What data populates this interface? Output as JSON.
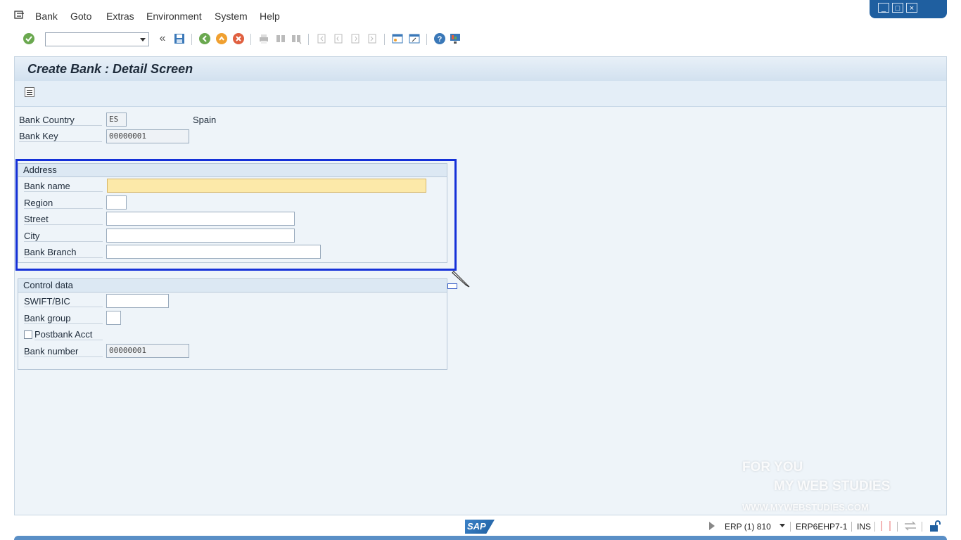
{
  "menubar": {
    "items": [
      "Bank",
      "Goto",
      "Extras",
      "Environment",
      "System",
      "Help"
    ]
  },
  "toolbar": {
    "command_field": "",
    "icons": [
      "enter-icon",
      "back-double-icon",
      "save-icon",
      "back-icon",
      "exit-icon",
      "cancel-icon",
      "print-icon",
      "find-icon",
      "find-next-icon",
      "first-page-icon",
      "prev-page-icon",
      "next-page-icon",
      "last-page-icon",
      "new-session-icon",
      "shortcut-icon",
      "help-icon",
      "customize-icon"
    ]
  },
  "screen": {
    "title": "Create Bank : Detail Screen"
  },
  "header_fields": {
    "bank_country_label": "Bank Country",
    "bank_country_value": "ES",
    "bank_country_name": "Spain",
    "bank_key_label": "Bank Key",
    "bank_key_value": "00000001"
  },
  "address": {
    "title": "Address",
    "bank_name_label": "Bank name",
    "bank_name_value": "",
    "region_label": "Region",
    "region_value": "",
    "street_label": "Street",
    "street_value": "",
    "city_label": "City",
    "city_value": "",
    "bank_branch_label": "Bank Branch",
    "bank_branch_value": ""
  },
  "control": {
    "title": "Control data",
    "swift_label": "SWIFT/BIC",
    "swift_value": "",
    "bank_group_label": "Bank group",
    "bank_group_value": "",
    "postbank_label": "Postbank Acct",
    "postbank_checked": false,
    "bank_number_label": "Bank number",
    "bank_number_value": "00000001"
  },
  "watermark": {
    "line1": "FOR YOU",
    "line2": "MY WEB STUDIES",
    "line3": "WWW.MYWEBSTUDIES.COM"
  },
  "statusbar": {
    "logo": "SAP",
    "system": "ERP (1) 810",
    "server": "ERP6EHP7-1",
    "mode": "INS"
  },
  "colors": {
    "highlight": "#1531d8",
    "active_field": "#fce9a9",
    "sap_blue": "#1f5fa0"
  }
}
